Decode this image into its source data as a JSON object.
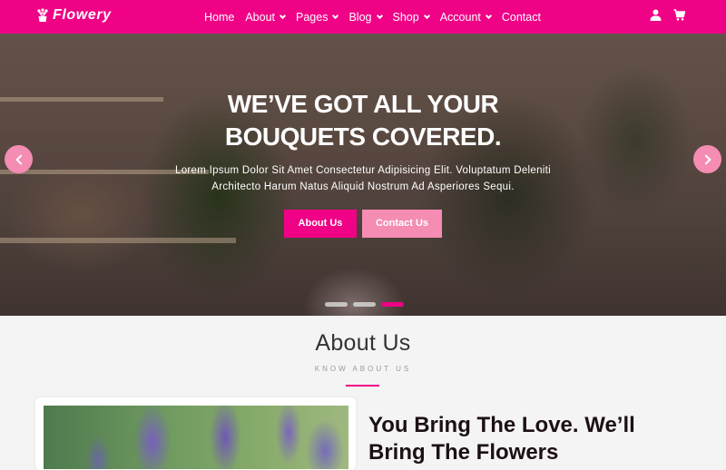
{
  "brand": {
    "name": "Flowery",
    "icon": "flower-pot-icon"
  },
  "nav": {
    "items": [
      {
        "label": "Home",
        "dropdown": false
      },
      {
        "label": "About",
        "dropdown": true
      },
      {
        "label": "Pages",
        "dropdown": true
      },
      {
        "label": "Blog",
        "dropdown": true
      },
      {
        "label": "Shop",
        "dropdown": true
      },
      {
        "label": "Account",
        "dropdown": true
      },
      {
        "label": "Contact",
        "dropdown": false
      }
    ],
    "icons": [
      "user-icon",
      "cart-icon"
    ]
  },
  "hero": {
    "title": "WE’VE GOT ALL YOUR BOUQUETS COVERED.",
    "subtitle": "Lorem Ipsum Dolor Sit Amet Consectetur Adipisicing Elit. Voluptatum Deleniti Architecto Harum Natus Aliquid Nostrum Ad Asperiores Sequi.",
    "primary_button": "About Us",
    "secondary_button": "Contact Us",
    "slides_total": 3,
    "active_slide": 3
  },
  "about": {
    "title": "About Us",
    "kicker": "KNOW ABOUT US",
    "heading": "You Bring The Love. We’ll Bring The Flowers"
  },
  "colors": {
    "accent": "#ef0286",
    "accent_light": "#f58cb3",
    "background": "#f4f4f4"
  }
}
